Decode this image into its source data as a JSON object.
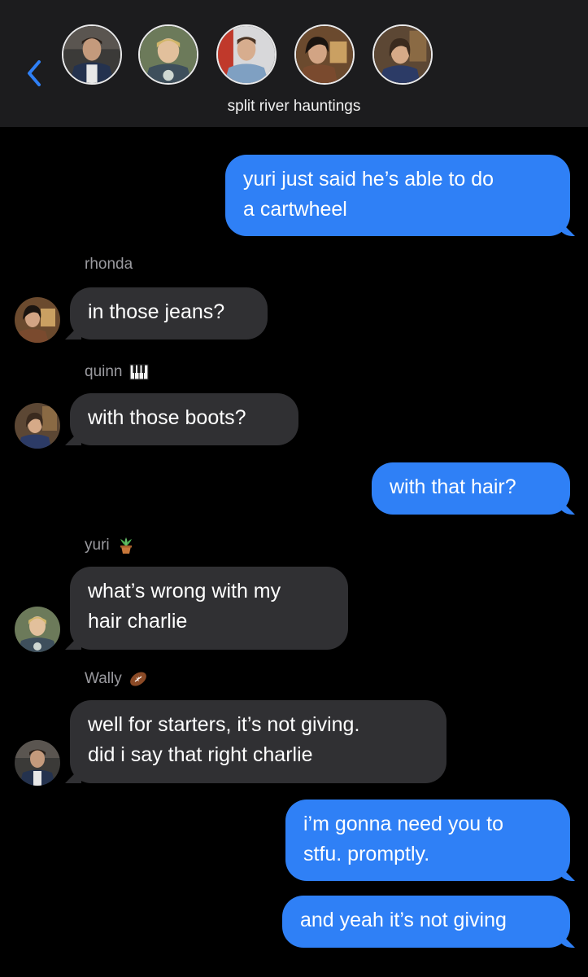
{
  "conversation": {
    "title": "split river hauntings"
  },
  "participants": [
    {
      "avatar": "wally-avatar"
    },
    {
      "avatar": "yuri-avatar"
    },
    {
      "avatar": "charlie-avatar"
    },
    {
      "avatar": "rhonda-avatar"
    },
    {
      "avatar": "quinn-avatar"
    }
  ],
  "messages": [
    {
      "from": "me",
      "text": "yuri just said he’s able to do\na cartwheel"
    },
    {
      "from": "rhonda",
      "sender_label": "rhonda",
      "text": "in those jeans?"
    },
    {
      "from": "quinn",
      "sender_label": "quinn",
      "sender_icon": "piano-keys-icon",
      "text": "with those boots?"
    },
    {
      "from": "me",
      "text": "with that hair?"
    },
    {
      "from": "yuri",
      "sender_label": "yuri",
      "sender_icon": "potted-plant-icon",
      "text": "what’s wrong with my\nhair charlie"
    },
    {
      "from": "Wally",
      "sender_label": "Wally",
      "sender_icon": "football-icon",
      "text": "well for starters, it’s not giving.\ndid i say that right charlie"
    },
    {
      "from": "me",
      "text": "i’m gonna need you to\nstfu. promptly."
    },
    {
      "from": "me",
      "text": "and yeah it’s not giving"
    }
  ],
  "colors": {
    "outgoing_bubble": "#2f80f6",
    "incoming_bubble": "#303033",
    "header_bg": "#1c1c1e",
    "accent": "#2f80f6"
  }
}
